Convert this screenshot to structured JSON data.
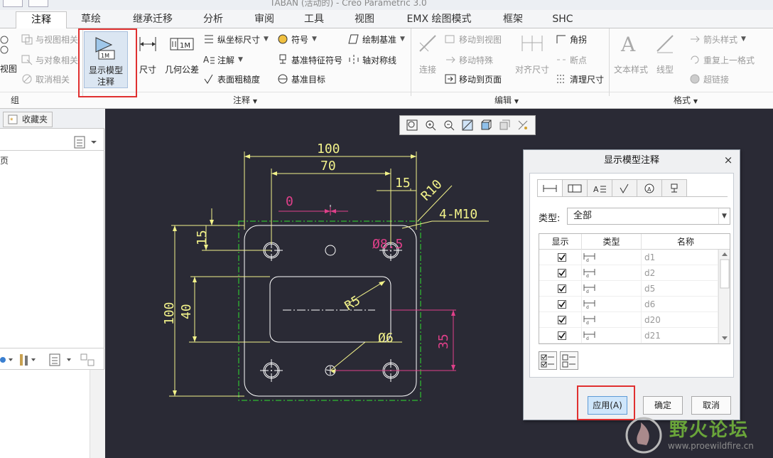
{
  "app_title": "TABAN (活动的) - Creo Parametric 3.0",
  "tabs": [
    {
      "label": "注释",
      "active": true
    },
    {
      "label": "草绘"
    },
    {
      "label": "继承迁移"
    },
    {
      "label": "分析"
    },
    {
      "label": "审阅"
    },
    {
      "label": "工具"
    },
    {
      "label": "视图"
    },
    {
      "label": "EMX 绘图模式"
    },
    {
      "label": "框架"
    },
    {
      "label": "SHC"
    }
  ],
  "ribbon": {
    "group_left": {
      "view_partial": "视图",
      "view_rel": "与视图相关",
      "obj_rel": "与对象相关",
      "cancel_rel": "取消相关",
      "group_label": "组"
    },
    "annotation": {
      "show_model_ann_line1": "显示模型",
      "show_model_ann_line2": "注释",
      "dimension": "尺寸",
      "gtol": "几何公差",
      "ordinate": "纵坐标尺寸",
      "note": "注解",
      "surface_finish": "表面粗糙度",
      "symbol": "符号",
      "datum_feature": "基准特征符号",
      "datum_target": "基准目标",
      "draw_datum": "绘制基准",
      "axis_sym": "轴对称线",
      "group_label": "注释"
    },
    "edit": {
      "connect": "连接",
      "move_to_view": "移动到视图",
      "move_special": "移动特殊",
      "move_to_page": "移动到页面",
      "align_dim": "对齐尺寸",
      "corner": "角拐",
      "breakpoint": "断点",
      "clean_dim": "清理尺寸",
      "group_label": "编辑"
    },
    "format": {
      "text_style": "文本样式",
      "line_style": "线型",
      "arrow_style": "箭头样式",
      "repeat_format": "重复上一格式",
      "hyperlink": "超链接",
      "group_label": "格式"
    }
  },
  "left_panel": {
    "tab_label": "收藏夹",
    "item_partial": "页"
  },
  "drawing": {
    "dims": {
      "d100_top": "100",
      "d70": "70",
      "d15_top": "15",
      "r10": "R10",
      "m10": "4-M10",
      "zero": "0",
      "d15_left": "15",
      "phi85": "Ø8.5",
      "d100_left": "100",
      "d40": "40",
      "r5": "R5",
      "phi6": "Ø6",
      "d35": "35"
    }
  },
  "dialog": {
    "title": "显示模型注释",
    "close": "×",
    "type_label": "类型:",
    "type_value": "全部",
    "columns": [
      "显示",
      "类型",
      "名称"
    ],
    "rows": [
      {
        "name": "d1"
      },
      {
        "name": "d2"
      },
      {
        "name": "d5"
      },
      {
        "name": "d6"
      },
      {
        "name": "d20"
      },
      {
        "name": "d21"
      }
    ],
    "apply": "应用(A)",
    "ok": "确定",
    "cancel": "取消"
  },
  "watermark": {
    "brand": "野火论坛",
    "url": "www.proewildfire.cn"
  },
  "colors": {
    "highlight_red": "#e03030",
    "drawing_yellow": "#f2f28a",
    "drawing_white": "#ffffff",
    "drawing_magenta": "#e0408a",
    "drawing_green": "#30e030",
    "canvas_bg": "#2a2a35",
    "apply_blue": "#cfe6fb"
  }
}
